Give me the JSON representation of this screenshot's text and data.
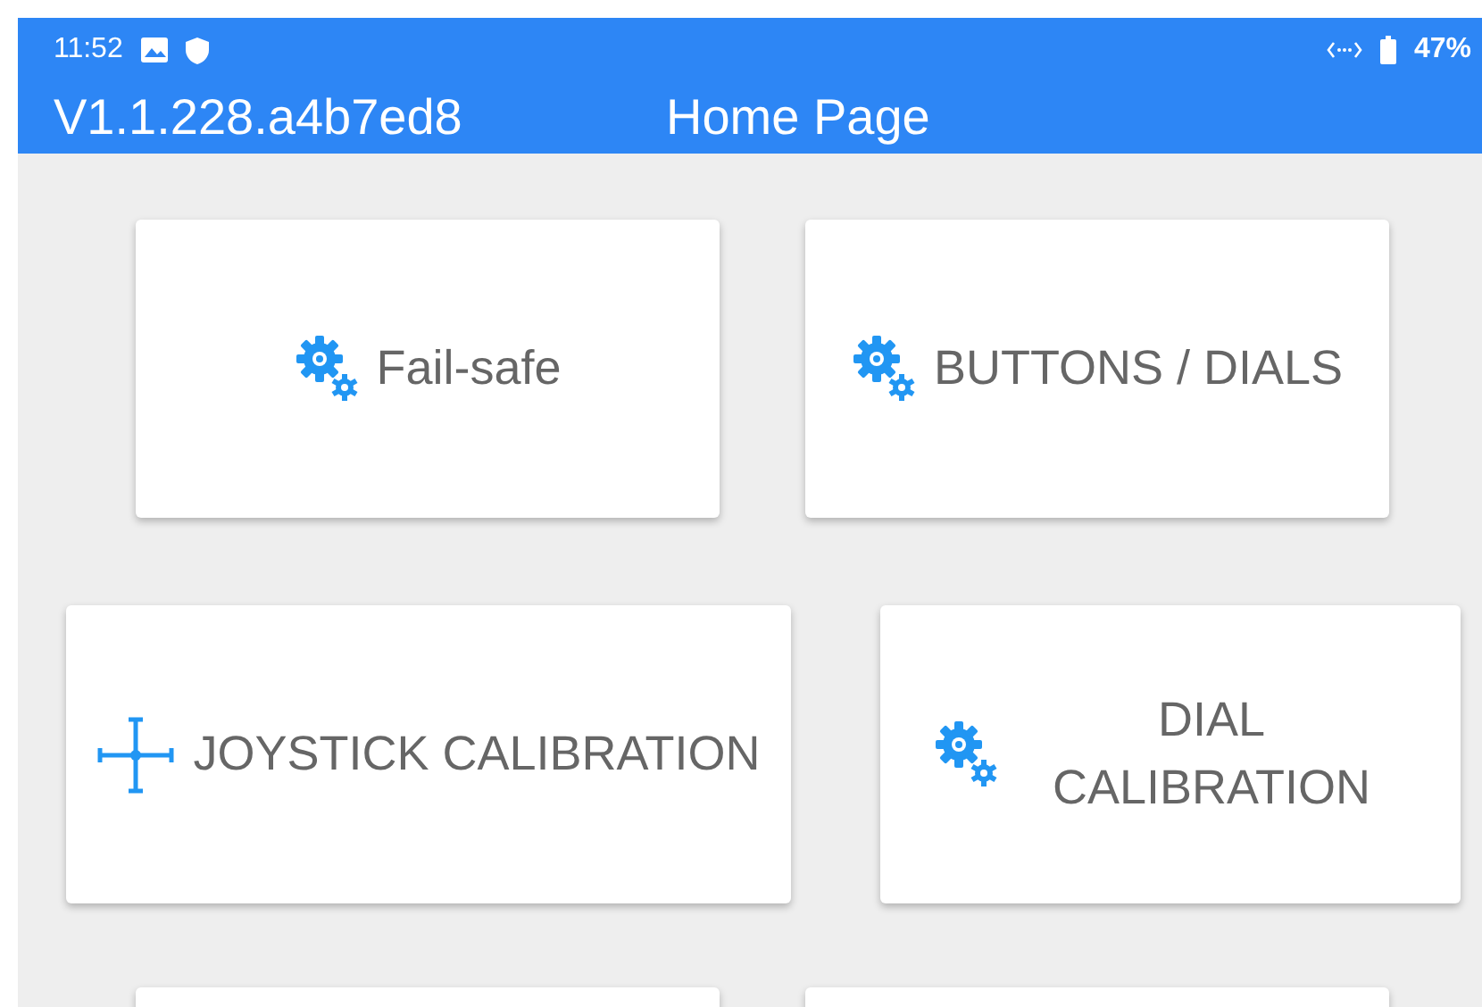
{
  "status_bar": {
    "time": "11:52",
    "battery": "47%"
  },
  "app_bar": {
    "version": "V1.1.228.a4b7ed8",
    "title": "Home Page"
  },
  "menu_rows": [
    {
      "cards": [
        {
          "kind": "gear",
          "label": "Fail-safe"
        },
        {
          "kind": "gear",
          "label": "BUTTONS / DIALS"
        }
      ]
    },
    {
      "cards": [
        {
          "kind": "crosshair",
          "label": "JOYSTICK CALIBRATION"
        },
        {
          "kind": "gear",
          "label": "DIAL CALIBRATION"
        }
      ]
    }
  ]
}
